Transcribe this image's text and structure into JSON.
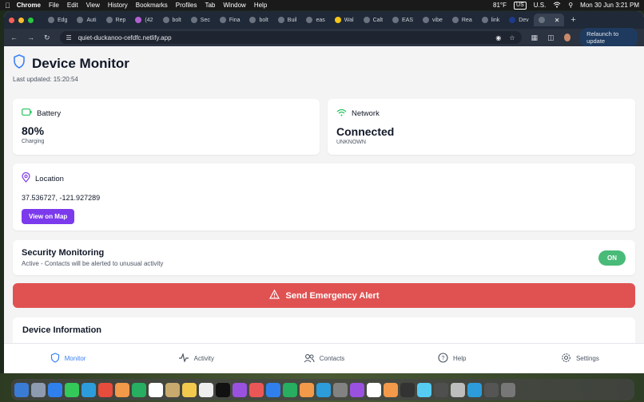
{
  "menubar": {
    "app": "Chrome",
    "items": [
      "File",
      "Edit",
      "View",
      "History",
      "Bookmarks",
      "Profiles",
      "Tab",
      "Window",
      "Help"
    ],
    "weather": "81°F",
    "input_source": "US",
    "input_label": "U.S.",
    "datetime": "Mon 30 Jun  3:21 PM"
  },
  "browser": {
    "tabs": [
      "Edg",
      "Auti",
      "Rep",
      "(42",
      "bolt",
      "Sec",
      "Fina",
      "bolt",
      "Buil",
      "eas",
      "Wal",
      "Calt",
      "EAS",
      "vibe",
      "Rea",
      "link",
      "Dev"
    ],
    "active_tab_index": 16,
    "url": "quiet-duckanoo-cefdfc.netlify.app",
    "relaunch_label": "Relaunch to update"
  },
  "page": {
    "title": "Device Monitor",
    "last_updated": "Last updated: 15:20:54",
    "battery": {
      "label": "Battery",
      "value": "80%",
      "status": "Charging"
    },
    "network": {
      "label": "Network",
      "value": "Connected",
      "status": "UNKNOWN"
    },
    "location": {
      "label": "Location",
      "coords": "37.536727, -121.927289",
      "button": "View on Map"
    },
    "security": {
      "title": "Security Monitoring",
      "subtitle": "Active - Contacts will be alerted to unusual activity",
      "toggle": "ON"
    },
    "alert_button": "Send Emergency Alert",
    "device_info_title": "Device Information"
  },
  "nav": {
    "items": [
      {
        "label": "Monitor",
        "icon": "shield-icon"
      },
      {
        "label": "Activity",
        "icon": "activity-icon"
      },
      {
        "label": "Contacts",
        "icon": "users-icon"
      },
      {
        "label": "Help",
        "icon": "help-icon"
      },
      {
        "label": "Settings",
        "icon": "gear-icon"
      }
    ],
    "active_index": 0
  },
  "colors": {
    "accent_blue": "#3b82f6",
    "purple": "#7c3aed",
    "alert_red": "#e05252",
    "toggle_green": "#48bb78",
    "network_green": "#22c55e"
  }
}
